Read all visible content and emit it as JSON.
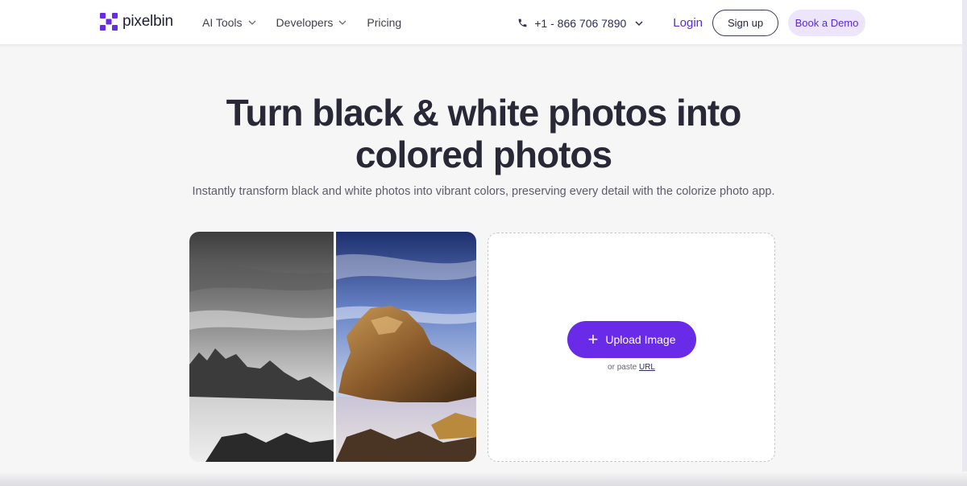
{
  "brand": {
    "name": "pixelbin",
    "accent": "#6a2be8"
  },
  "nav": {
    "items": [
      {
        "label": "AI Tools",
        "has_dropdown": true
      },
      {
        "label": "Developers",
        "has_dropdown": true
      },
      {
        "label": "Pricing",
        "has_dropdown": false
      }
    ]
  },
  "header_right": {
    "phone": "+1 - 866 706 7890",
    "login": "Login",
    "signup": "Sign up",
    "demo": "Book a Demo"
  },
  "hero": {
    "title_line1": "Turn black & white photos into",
    "title_line2": "colored photos",
    "subtitle": "Instantly transform black and white photos into vibrant colors, preserving every detail with the colorize photo app."
  },
  "upload": {
    "button": "Upload Image",
    "paste_prefix": "or paste",
    "paste_link": "URL"
  }
}
